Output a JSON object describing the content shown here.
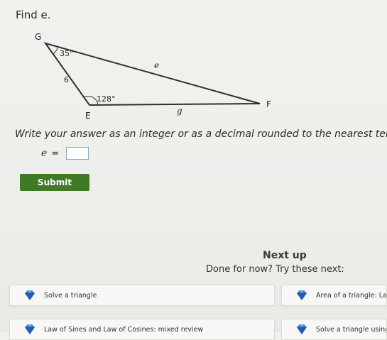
{
  "problem": {
    "prompt": "Find e.",
    "figure": {
      "vertices": {
        "G": "G",
        "E": "E",
        "F": "F"
      },
      "angles": {
        "G": "35°",
        "E": "128°"
      },
      "sides": {
        "GE": "6",
        "GF": "e",
        "EF": "g"
      }
    },
    "instruction": "Write your answer as an integer or as a decimal rounded to the nearest tenth.",
    "answer": {
      "variable": "e",
      "equals": "=",
      "value": ""
    },
    "submit_label": "Submit"
  },
  "next": {
    "heading": "Next up",
    "subheading": "Done for now? Try these next:",
    "items": [
      {
        "label": "Solve a triangle"
      },
      {
        "label": "Area of a triangle: Law of Sines"
      },
      {
        "label": "Law of Sines and Law of Cosines: mixed review"
      },
      {
        "label": "Solve a triangle using the Law of Sines"
      }
    ]
  },
  "colors": {
    "submit": "#3f7b27",
    "gem": "#2c7bd0",
    "input_border": "#8aa7c7"
  }
}
